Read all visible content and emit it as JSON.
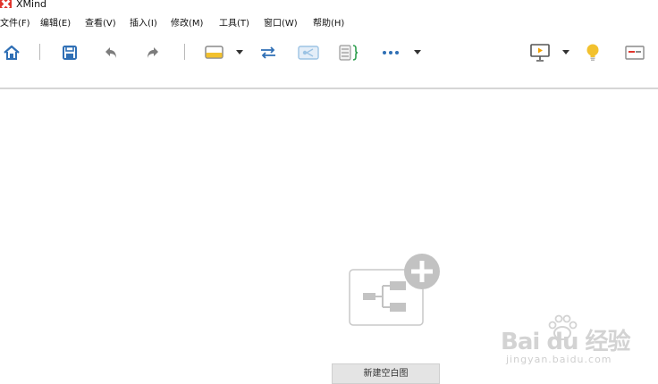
{
  "window": {
    "title": "XMind"
  },
  "menu": {
    "items": [
      "文件(F)",
      "编辑(E)",
      "查看(V)",
      "插入(I)",
      "修改(M)",
      "工具(T)",
      "窗口(W)",
      "帮助(H)"
    ]
  },
  "toolbar": {
    "icons": [
      "home-icon",
      "save-icon",
      "undo-icon",
      "redo-icon",
      "topic-style-icon",
      "relationship-icon",
      "boundary-icon",
      "summary-icon",
      "more-icon",
      "presentation-icon",
      "idea-bulb-icon",
      "panel-icon"
    ],
    "colors": {
      "blue": "#2f6fb5",
      "gray": "#7d7d7d",
      "yellow": "#f2c12e",
      "light_blue": "#9cc3e4"
    }
  },
  "main": {
    "new_blank_label": "新建空白图"
  },
  "watermark": {
    "logo_text": "Bai du 经验",
    "sub_text": "jingyan.baidu.com"
  }
}
